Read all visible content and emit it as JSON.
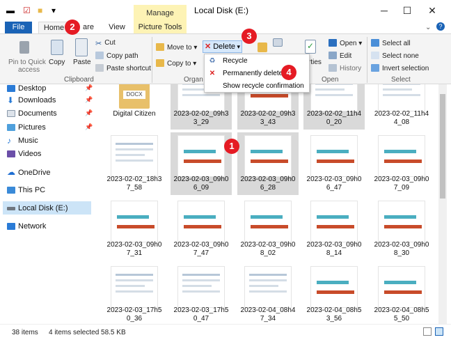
{
  "window": {
    "title": "Local Disk (E:)",
    "context_tab": "Manage",
    "minimize_icon": "minimize-icon",
    "maximize_icon": "maximize-icon",
    "close_icon": "close-icon"
  },
  "tabs": [
    "File",
    "Home",
    "Share",
    "View",
    "Picture Tools"
  ],
  "ribbon": {
    "clipboard": {
      "label": "Clipboard",
      "pin_quick": "Pin to Quick",
      "pin_quick_2": "access",
      "copy": "Copy",
      "paste": "Paste",
      "cut": "Cut",
      "copy_path": "Copy path",
      "paste_shortcut": "Paste shortcut"
    },
    "organize": {
      "label": "Organ",
      "move_to": "Move to",
      "copy_to": "Copy to",
      "delete": "Delete"
    },
    "open": {
      "label": "Open",
      "properties": "rties",
      "open": "Open",
      "edit": "Edit",
      "history": "History"
    },
    "select": {
      "label": "Select",
      "select_all": "Select all",
      "select_none": "Select none",
      "invert": "Invert selection"
    }
  },
  "delete_menu": {
    "recycle": "Recycle",
    "permanently": "Permanently delete",
    "show_confirm": "Show recycle confirmation"
  },
  "nav": {
    "items": [
      "Desktop",
      "Downloads",
      "Documents",
      "Pictures",
      "Music",
      "Videos",
      "OneDrive",
      "This PC",
      "Local Disk (E:)",
      "Network"
    ]
  },
  "files": [
    {
      "name": "Digital Citizen",
      "type": "folder"
    },
    {
      "name": "2023-02-02_09h3\n3_29",
      "type": "image"
    },
    {
      "name": "2023-02-02_09h3\n3_43",
      "type": "chart"
    },
    {
      "name": "2023-02-02_11h4\n0_20",
      "type": "image"
    },
    {
      "name": "2023-02-02_11h4\n4_08",
      "type": "image"
    },
    {
      "name": "2023-02-02_18h3\n7_58",
      "type": "image"
    },
    {
      "name": "2023-02-03_09h0\n6_09",
      "type": "chart"
    },
    {
      "name": "2023-02-03_09h0\n6_28",
      "type": "chart"
    },
    {
      "name": "2023-02-03_09h0\n6_47",
      "type": "chart"
    },
    {
      "name": "2023-02-03_09h0\n7_09",
      "type": "chart"
    },
    {
      "name": "2023-02-03_09h0\n7_31",
      "type": "chart"
    },
    {
      "name": "2023-02-03_09h0\n7_47",
      "type": "chart"
    },
    {
      "name": "2023-02-03_09h0\n8_02",
      "type": "chart"
    },
    {
      "name": "2023-02-03_09h0\n8_14",
      "type": "chart"
    },
    {
      "name": "2023-02-03_09h0\n8_30",
      "type": "chart"
    },
    {
      "name": "2023-02-03_17h5\n0_36",
      "type": "image"
    },
    {
      "name": "2023-02-03_17h5\n0_47",
      "type": "image"
    },
    {
      "name": "2023-02-04_08h4\n7_34",
      "type": "image"
    },
    {
      "name": "2023-02-04_08h5\n3_56",
      "type": "chart"
    },
    {
      "name": "2023-02-04_08h5\n5_50",
      "type": "chart"
    }
  ],
  "status": {
    "count": "38 items",
    "selected": "4 items selected  58.5 KB"
  },
  "badges": [
    "1",
    "2",
    "3",
    "4"
  ],
  "colors": {
    "accent": "#1a63b6",
    "delete_red": "#d22",
    "badge": "#e51b24",
    "teal_bar": "#4aaec0",
    "orange_bar": "#c84b2a",
    "selection": "#cce4f7"
  }
}
